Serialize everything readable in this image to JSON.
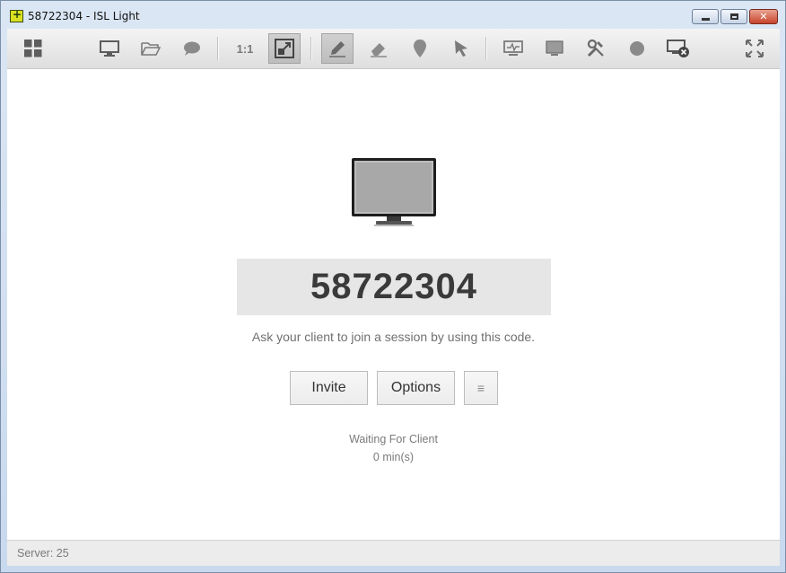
{
  "window": {
    "title": "58722304 - ISL Light"
  },
  "toolbar": {
    "items": [
      {
        "name": "grid-icon"
      },
      {
        "name": "monitor-icon"
      },
      {
        "name": "folder-icon"
      },
      {
        "name": "chat-icon"
      },
      {
        "name": "ratio-label",
        "label": "1:1"
      },
      {
        "name": "fit-screen-icon",
        "active": true
      },
      {
        "name": "pencil-icon",
        "active": true
      },
      {
        "name": "eraser-icon"
      },
      {
        "name": "marker-icon"
      },
      {
        "name": "pointer-icon"
      },
      {
        "name": "system-monitor-icon"
      },
      {
        "name": "display-icon"
      },
      {
        "name": "tools-icon"
      },
      {
        "name": "record-icon"
      },
      {
        "name": "disconnect-monitor-icon"
      },
      {
        "name": "fullscreen-icon"
      }
    ]
  },
  "session": {
    "code": "58722304",
    "hint": "Ask your client to join a session by using this code.",
    "invite_label": "Invite",
    "options_label": "Options",
    "menu_label": "≡",
    "status": "Waiting For Client",
    "elapsed": "0 min(s)"
  },
  "statusbar": {
    "server": "Server: 25"
  },
  "colors": {
    "toolbar_bg": "#e6e6e6",
    "code_box_bg": "#e6e6e6",
    "icon_gray": "#6c6c6c",
    "title_bar": "#c9d9ee",
    "close_button": "#c7432b"
  }
}
